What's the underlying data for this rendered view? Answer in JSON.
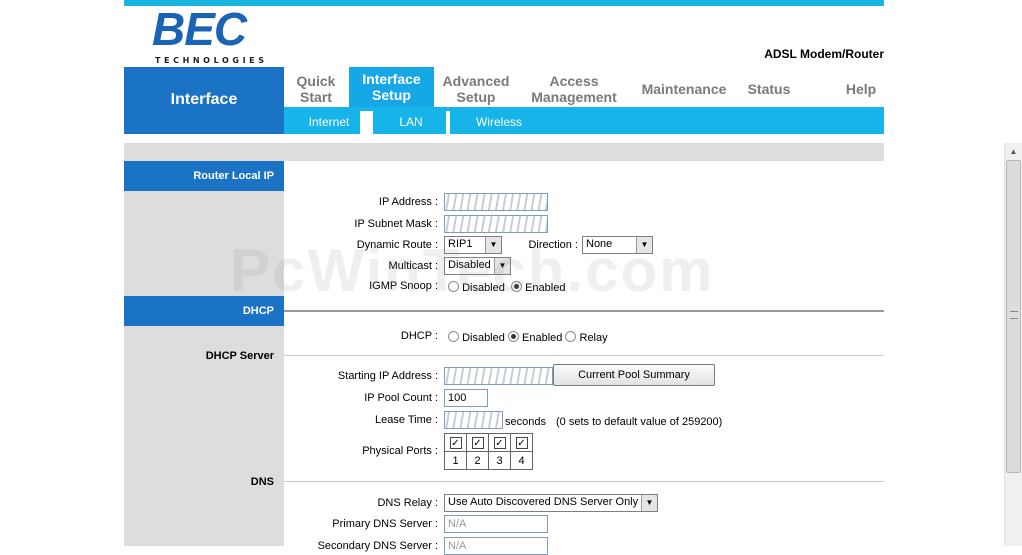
{
  "header": {
    "logo_text": "BEC",
    "logo_sub": "TECHNOLOGIES",
    "product": "ADSL Modem/Router"
  },
  "nav": {
    "section_title": "Interface",
    "tabs": [
      {
        "label": "Quick\nStart"
      },
      {
        "label": "Interface\nSetup"
      },
      {
        "label": "Advanced\nSetup"
      },
      {
        "label": "Access\nManagement"
      },
      {
        "label": "Maintenance"
      },
      {
        "label": "Status"
      },
      {
        "label": "Help"
      }
    ],
    "subtabs": [
      {
        "label": "Internet"
      },
      {
        "label": "LAN"
      },
      {
        "label": "Wireless"
      }
    ]
  },
  "sections": {
    "router_local_ip": "Router Local IP",
    "dhcp": "DHCP",
    "dhcp_server": "DHCP Server",
    "dns": "DNS"
  },
  "router": {
    "ip_address_label": "IP Address :",
    "subnet_label": "IP Subnet Mask :",
    "dynamic_route_label": "Dynamic Route :",
    "dynamic_route_value": "RIP1",
    "direction_label": "Direction :",
    "direction_value": "None",
    "multicast_label": "Multicast :",
    "multicast_value": "Disabled",
    "igmp_label": "IGMP Snoop :",
    "igmp_disabled": "Disabled",
    "igmp_enabled": "Enabled"
  },
  "dhcp": {
    "label": "DHCP :",
    "opt_disabled": "Disabled",
    "opt_enabled": "Enabled",
    "opt_relay": "Relay",
    "start_ip_label": "Starting IP Address :",
    "pool_button": "Current Pool Summary",
    "pool_count_label": "IP Pool Count :",
    "pool_count_value": "100",
    "lease_label": "Lease Time :",
    "lease_unit": "seconds",
    "lease_note": "(0 sets to default value of 259200)",
    "ports_label": "Physical Ports :",
    "ports": [
      "1",
      "2",
      "3",
      "4"
    ]
  },
  "dns": {
    "relay_label": "DNS Relay :",
    "relay_value": "Use Auto Discovered DNS Server Only",
    "primary_label": "Primary DNS Server :",
    "primary_value": "N/A",
    "secondary_label": "Secondary DNS Server :",
    "secondary_value": "N/A"
  },
  "watermark": "PcWinTech.com",
  "colors": {
    "brand_blue": "#1b73c5",
    "tab_cyan": "#16b4e8",
    "panel_gray": "#dddddd"
  }
}
